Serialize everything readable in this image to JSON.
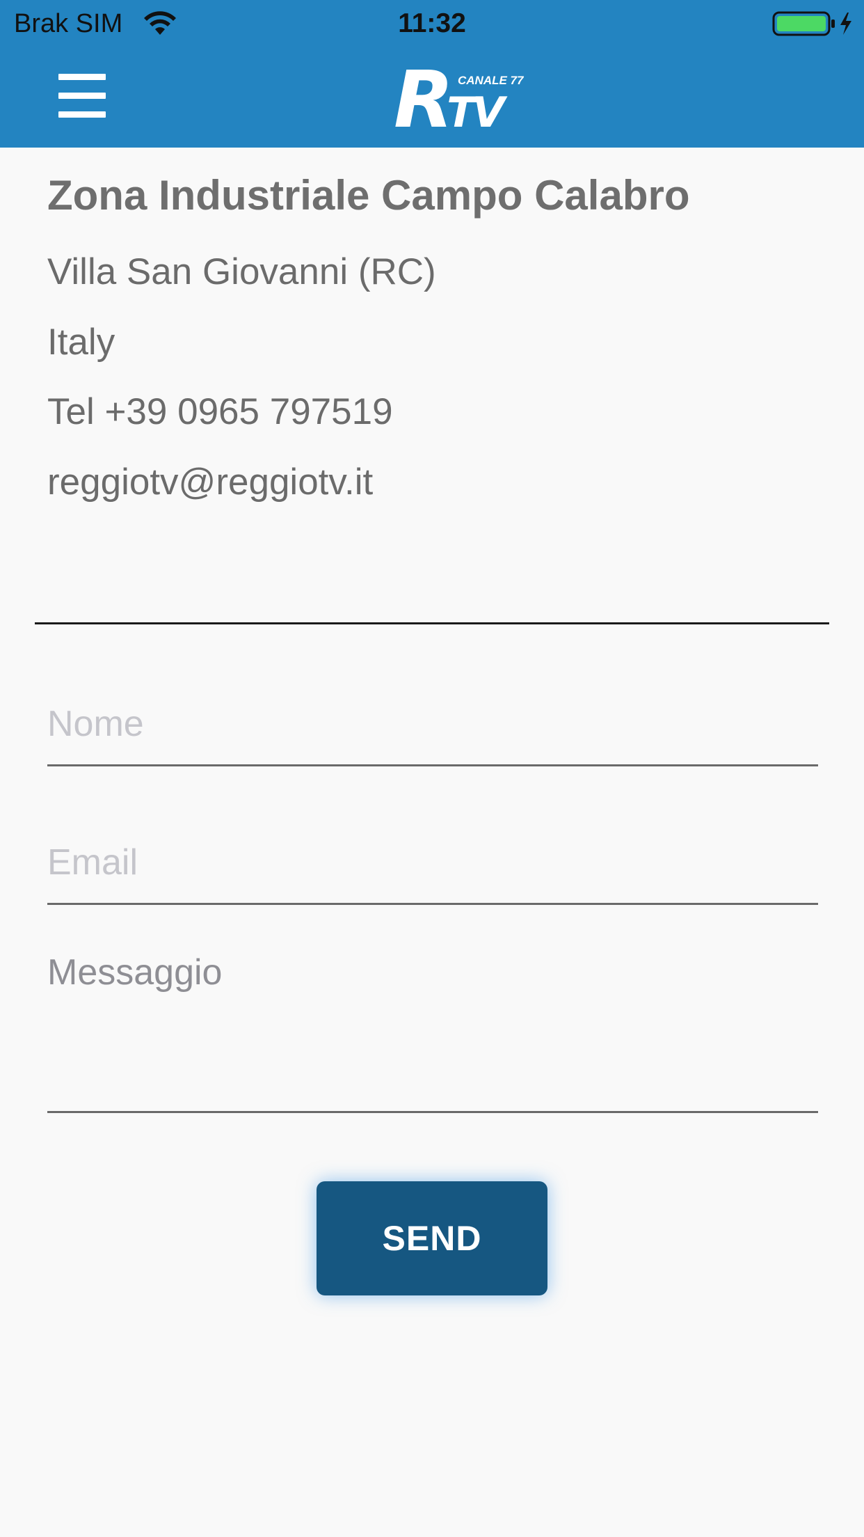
{
  "status_bar": {
    "carrier": "Brak SIM",
    "time": "11:32",
    "icons": [
      "wifi-icon",
      "battery-charging-icon"
    ]
  },
  "header": {
    "menu_icon": "hamburger-menu-icon",
    "logo": {
      "mark_r": "R",
      "mark_tv": "TV",
      "channel": "CANALE 77"
    }
  },
  "address": {
    "title": "Zona Industriale Campo Calabro",
    "city": "Villa San Giovanni (RC)",
    "country": "Italy",
    "phone": "Tel +39 0965 797519",
    "email": "reggiotv@reggiotv.it"
  },
  "form": {
    "name": {
      "value": "",
      "placeholder": "Nome"
    },
    "email": {
      "value": "",
      "placeholder": "Email"
    },
    "message": {
      "value": "",
      "placeholder": "Messaggio"
    },
    "send_label": "SEND"
  },
  "colors": {
    "header_bg": "#2384c1",
    "button_bg": "#165781",
    "battery": "#4cd964",
    "page_bg": "#f9f9f9"
  }
}
